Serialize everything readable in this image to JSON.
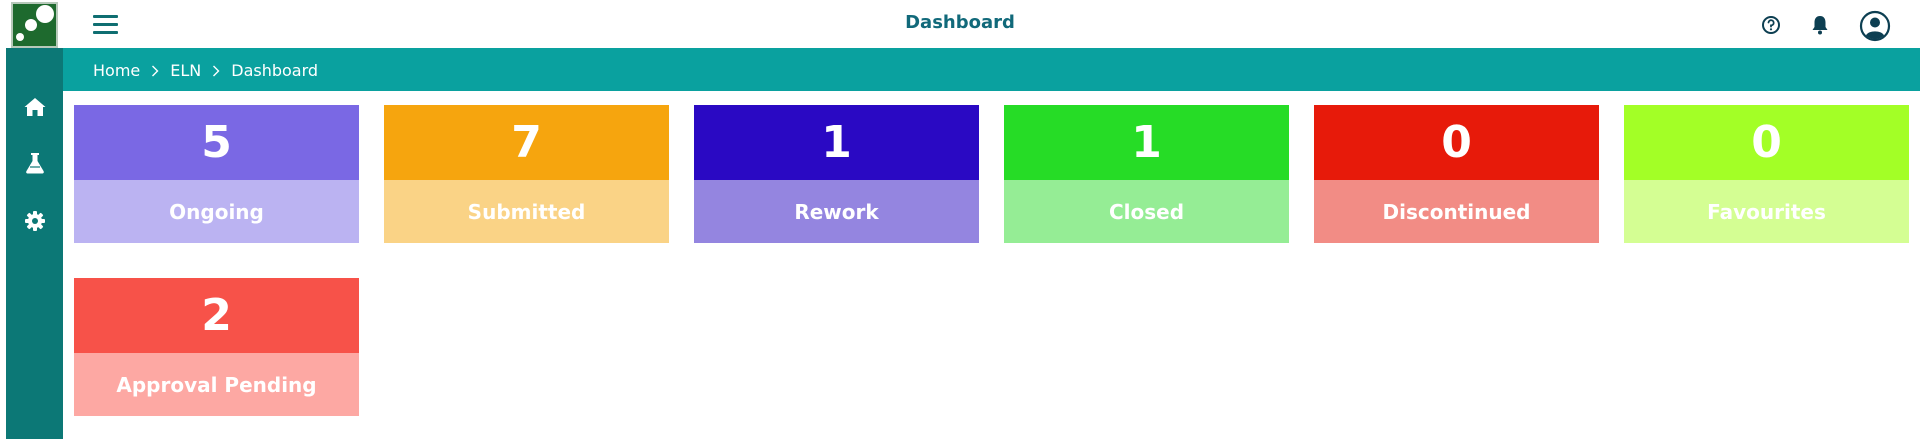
{
  "header": {
    "title": "Dashboard",
    "icons": [
      "hamburger-menu-icon",
      "help-circle-icon",
      "bell-icon",
      "user-account-icon"
    ]
  },
  "breadcrumb": [
    "Home",
    "ELN",
    "Dashboard"
  ],
  "sidebar": {
    "items": [
      {
        "name": "home",
        "icon": "home-icon"
      },
      {
        "name": "lab",
        "icon": "flask-icon"
      },
      {
        "name": "settings",
        "icon": "gear-icon"
      }
    ]
  },
  "tiles": [
    {
      "count": "5",
      "label": "Ongoing",
      "color_top": "#7a68e4",
      "color_bottom": "#bbb3f2"
    },
    {
      "count": "7",
      "label": "Submitted",
      "color_top": "#f6a50e",
      "color_bottom": "#fad386"
    },
    {
      "count": "1",
      "label": "Rework",
      "color_top": "#2a09c3",
      "color_bottom": "#9485e0"
    },
    {
      "count": "1",
      "label": "Closed",
      "color_top": "#26dc26",
      "color_bottom": "#95ed95"
    },
    {
      "count": "0",
      "label": "Discontinued",
      "color_top": "#e71a0a",
      "color_bottom": "#f28c85"
    },
    {
      "count": "0",
      "label": "Favourites",
      "color_top": "#a3ff26",
      "color_bottom": "#d4fe93"
    },
    {
      "count": "2",
      "label": "Approval Pending",
      "color_top": "#f75249",
      "color_bottom": "#fda8a3"
    }
  ],
  "colors": {
    "header_text": "#11697a",
    "sidebar": "#0c7876",
    "breadcrumb_bar": "#0aa19f"
  }
}
